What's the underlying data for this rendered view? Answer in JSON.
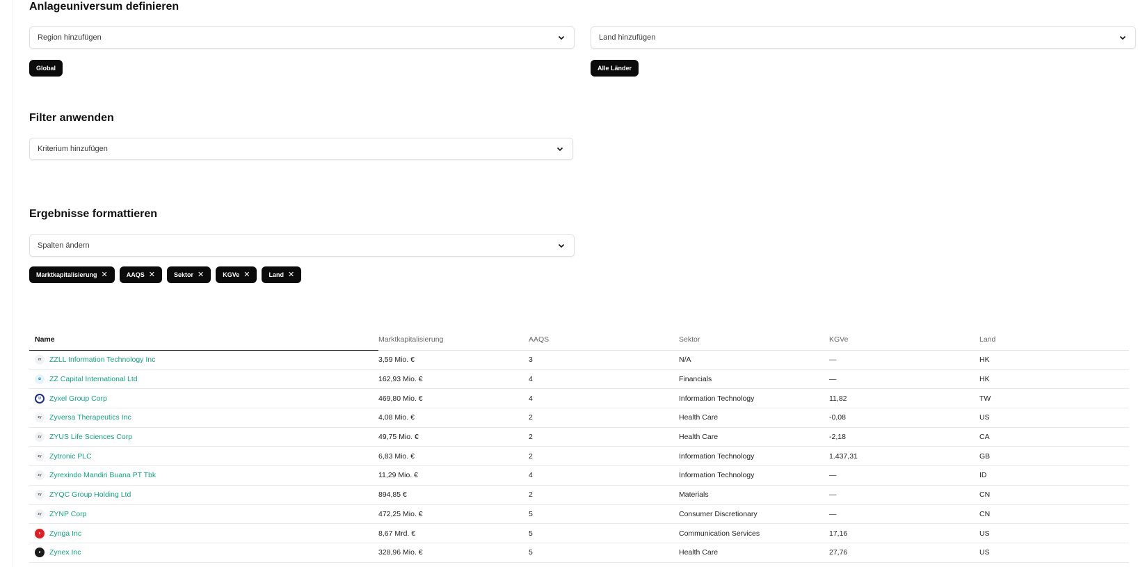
{
  "universe": {
    "heading": "Anlageuniversum definieren",
    "region_placeholder": "Region hinzufügen",
    "country_placeholder": "Land hinzufügen",
    "region_chip": "Global",
    "country_chip": "Alle Länder"
  },
  "filter": {
    "heading": "Filter anwenden",
    "criterion_placeholder": "Kriterium hinzufügen"
  },
  "format": {
    "heading": "Ergebnisse formattieren",
    "columns_placeholder": "Spalten ändern",
    "column_chips": [
      "Marktkapitalisierung",
      "AAQS",
      "Sektor",
      "KGVe",
      "Land"
    ]
  },
  "table": {
    "headers": [
      "Name",
      "Marktkapitalisierung",
      "AAQS",
      "Sektor",
      "KGVe",
      "Land"
    ],
    "rows": [
      {
        "logo": "plain",
        "logo_text": "zz",
        "name": "ZZLL Information Technology Inc",
        "cap": "3,59 Mio. €",
        "aaqs": "3",
        "sector": "N/A",
        "kgve": "—",
        "land": "HK"
      },
      {
        "logo": "blue",
        "logo_text": "✿",
        "name": "ZZ Capital International Ltd",
        "cap": "162,93 Mio. €",
        "aaqs": "4",
        "sector": "Financials",
        "kgve": "—",
        "land": "HK"
      },
      {
        "logo": "navy",
        "logo_text": "U",
        "name": "Zyxel Group Corp",
        "cap": "469,80 Mio. €",
        "aaqs": "4",
        "sector": "Information Technology",
        "kgve": "11,82",
        "land": "TW"
      },
      {
        "logo": "plain",
        "logo_text": "zy",
        "name": "Zyversa Therapeutics Inc",
        "cap": "4,08 Mio. €",
        "aaqs": "2",
        "sector": "Health Care",
        "kgve": "-0,08",
        "land": "US"
      },
      {
        "logo": "plain",
        "logo_text": "zy",
        "name": "ZYUS Life Sciences Corp",
        "cap": "49,75 Mio. €",
        "aaqs": "2",
        "sector": "Health Care",
        "kgve": "-2,18",
        "land": "CA"
      },
      {
        "logo": "plain",
        "logo_text": "zy",
        "name": "Zytronic PLC",
        "cap": "6,83 Mio. €",
        "aaqs": "2",
        "sector": "Information Technology",
        "kgve": "1.437,31",
        "land": "GB"
      },
      {
        "logo": "plain",
        "logo_text": "zy",
        "name": "Zyrexindo Mandiri Buana PT Tbk",
        "cap": "11,29 Mio. €",
        "aaqs": "4",
        "sector": "Information Technology",
        "kgve": "—",
        "land": "ID"
      },
      {
        "logo": "plain",
        "logo_text": "zy",
        "name": "ZYQC Group Holding Ltd",
        "cap": "894,85 €",
        "aaqs": "2",
        "sector": "Materials",
        "kgve": "—",
        "land": "CN"
      },
      {
        "logo": "plain",
        "logo_text": "zy",
        "name": "ZYNP Corp",
        "cap": "472,25 Mio. €",
        "aaqs": "5",
        "sector": "Consumer Discretionary",
        "kgve": "—",
        "land": "CN"
      },
      {
        "logo": "red",
        "logo_text": "z",
        "name": "Zynga Inc",
        "cap": "8,67 Mrd. €",
        "aaqs": "5",
        "sector": "Communication Services",
        "kgve": "17,16",
        "land": "US"
      },
      {
        "logo": "black",
        "logo_text": "z",
        "name": "Zynex Inc",
        "cap": "328,96 Mio. €",
        "aaqs": "5",
        "sector": "Health Care",
        "kgve": "27,76",
        "land": "US"
      }
    ]
  }
}
